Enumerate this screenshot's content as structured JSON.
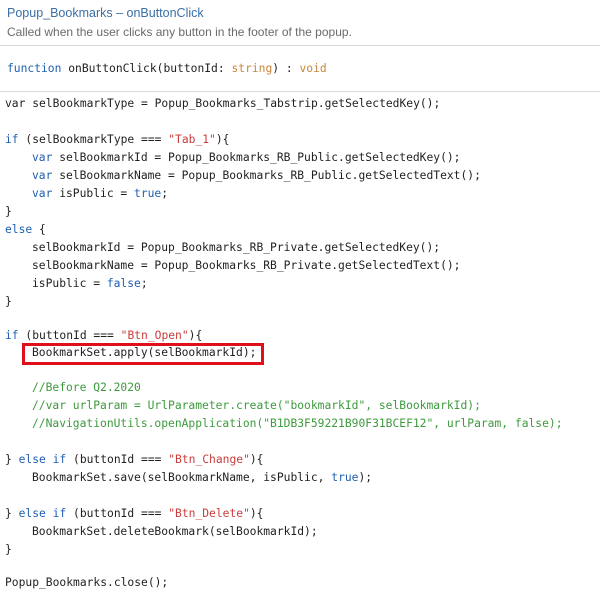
{
  "header": {
    "title": "Popup_Bookmarks – onButtonClick",
    "subtitle": "Called when the user clicks any button in the footer of the popup."
  },
  "signature": {
    "keyword": "function",
    "name": " onButtonClick(buttonId: ",
    "param_type": "string",
    "mid": ") : ",
    "return_type": "void"
  },
  "code": {
    "l1": "var selBookmarkType = Popup_Bookmarks_Tabstrip.getSelectedKey();",
    "l2_kw": "if",
    "l2_a": " (selBookmarkType === ",
    "l2_str": "\"Tab_1\"",
    "l2_b": "){",
    "l3_kw": "var",
    "l3": " selBookmarkId = Popup_Bookmarks_RB_Public.getSelectedKey();",
    "l4_kw": "var",
    "l4": " selBookmarkName = Popup_Bookmarks_RB_Public.getSelectedText();",
    "l5_kw": "var",
    "l5_a": " isPublic = ",
    "l5_val": "true",
    "l5_b": ";",
    "l6": "}",
    "l7_kw": "else",
    "l7_b": " {",
    "l8": "selBookmarkId = Popup_Bookmarks_RB_Private.getSelectedKey();",
    "l9": "selBookmarkName = Popup_Bookmarks_RB_Private.getSelectedText();",
    "l10_a": "isPublic = ",
    "l10_val": "false",
    "l10_b": ";",
    "l11": "}",
    "l12_kw": "if",
    "l12_a": " (buttonId === ",
    "l12_str": "\"Btn_Open\"",
    "l12_b": "){",
    "l13": "BookmarkSet.apply(selBookmarkId);",
    "l14": "//Before Q2.2020",
    "l15": "//var urlParam = UrlParameter.create(\"bookmarkId\", selBookmarkId);",
    "l16": "//NavigationUtils.openApplication(\"B1DB3F59221B90F31BCEF12\", urlParam, false);",
    "l17_a": "} ",
    "l17_kw": "else if",
    "l17_b": " (buttonId === ",
    "l17_str": "\"Btn_Change\"",
    "l17_c": "){",
    "l18_a": "BookmarkSet.save(selBookmarkName, isPublic, ",
    "l18_val": "true",
    "l18_b": ");",
    "l19_a": "} ",
    "l19_kw": "else if",
    "l19_b": " (buttonId === ",
    "l19_str": "\"Btn_Delete\"",
    "l19_c": "){",
    "l20": "BookmarkSet.deleteBookmark(selBookmarkId);",
    "l21": "}",
    "l22": "Popup_Bookmarks.close();"
  },
  "colors": {
    "keyword": "#1f5fb0",
    "string": "#c93c3c",
    "type": "#c9853b",
    "comment": "#3d9a3d",
    "highlight": "#e0101a"
  }
}
